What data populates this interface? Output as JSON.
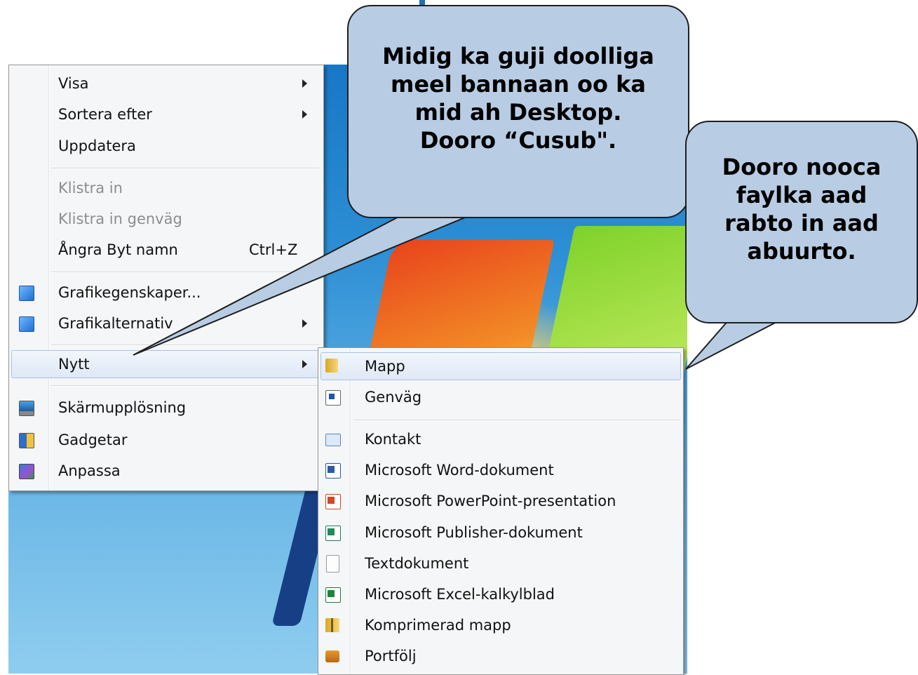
{
  "context_menu": {
    "items": [
      {
        "label": "Visa",
        "submenu": true
      },
      {
        "label": "Sortera efter",
        "submenu": true
      },
      {
        "label": "Uppdatera"
      },
      {
        "label": "Klistra in",
        "disabled": true
      },
      {
        "label": "Klistra in genväg",
        "disabled": true
      },
      {
        "label": "Ångra Byt namn",
        "shortcut": "Ctrl+Z"
      },
      {
        "label": "Grafikegenskaper...",
        "icon": "graphics-properties-icon"
      },
      {
        "label": "Grafikalternativ",
        "icon": "graphics-options-icon",
        "submenu": true
      },
      {
        "label": "Nytt",
        "submenu": true,
        "highlighted": true
      },
      {
        "label": "Skärmupplösning",
        "icon": "screen-resolution-icon"
      },
      {
        "label": "Gadgetar",
        "icon": "gadgets-icon"
      },
      {
        "label": "Anpassa",
        "icon": "personalize-icon"
      }
    ]
  },
  "new_submenu": {
    "items": [
      {
        "label": "Mapp",
        "icon": "folder-icon",
        "highlighted": true
      },
      {
        "label": "Genväg",
        "icon": "shortcut-icon"
      },
      {
        "label": "Kontakt",
        "icon": "contact-icon"
      },
      {
        "label": "Microsoft Word-dokument",
        "icon": "word-document-icon"
      },
      {
        "label": "Microsoft PowerPoint-presentation",
        "icon": "powerpoint-icon"
      },
      {
        "label": "Microsoft Publisher-dokument",
        "icon": "publisher-icon"
      },
      {
        "label": "Textdokument",
        "icon": "text-document-icon"
      },
      {
        "label": "Microsoft Excel-kalkylblad",
        "icon": "excel-icon"
      },
      {
        "label": "Komprimerad mapp",
        "icon": "zip-folder-icon"
      },
      {
        "label": "Portfölj",
        "icon": "briefcase-icon"
      }
    ]
  },
  "callouts": {
    "first": {
      "lines": [
        "Midig ka guji doolliga",
        "meel bannaan oo ka",
        "mid ah Desktop.",
        "Dooro “Cusub\"."
      ]
    },
    "second": {
      "lines": [
        "Dooro nooca",
        "faylka aad",
        "rabto in aad",
        "abuurto."
      ]
    }
  },
  "colors": {
    "callout_fill": "#b8cde4",
    "menu_background": "#f5f6f8",
    "highlight": "#dfe8f6"
  }
}
